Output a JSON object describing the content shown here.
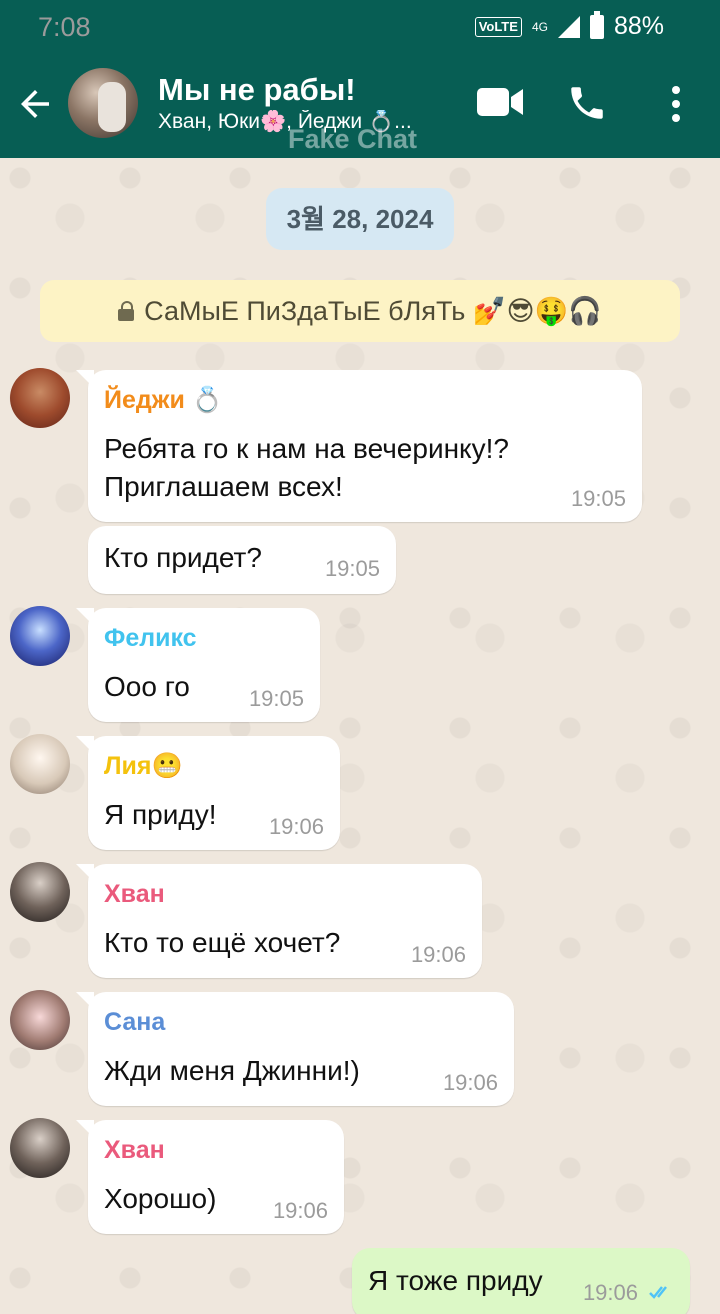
{
  "status_bar": {
    "time": "7:08",
    "network": "VoLTE",
    "network_gen": "4G",
    "battery_percent": "88%"
  },
  "header": {
    "title": "Мы не рабы!",
    "subtitle": "Хван, Юки🌸, Йеджи 💍...",
    "watermark": "Fake Chat"
  },
  "date_chip": "3월 28, 2024",
  "pinned_banner": {
    "text": "СаМыЕ ПиЗдаТыЕ бЛяТь 💅😎🤑🎧"
  },
  "messages": [
    {
      "sender": "Йеджи 💍",
      "text": "Ребята го к нам на вечеринку!?\nПриглашаем всех!",
      "time": "19:05",
      "color": "#f28c1b"
    },
    {
      "text": "Кто придет?",
      "time": "19:05"
    },
    {
      "sender": "Феликс",
      "text": "Ооо го",
      "time": "19:05",
      "color": "#41c3ee"
    },
    {
      "sender": "Лия😬",
      "text": "Я приду!",
      "time": "19:06",
      "color": "#f4c20d"
    },
    {
      "sender": "Хван",
      "text": "Кто то ещё хочет?",
      "time": "19:06",
      "color": "#ea5a7c"
    },
    {
      "sender": "Сана",
      "text": "Жди меня Джинни!)",
      "time": "19:06",
      "color": "#5b8ed6"
    },
    {
      "sender": "Хван",
      "text": "Хорошо)",
      "time": "19:06",
      "color": "#ea5a7c"
    },
    {
      "outgoing": true,
      "text": "Я тоже приду",
      "time": "19:06"
    }
  ],
  "icons": {
    "back": "arrow-left-icon",
    "video": "video-call-icon",
    "phone": "phone-icon",
    "menu": "more-vert-icon",
    "lock": "lock-icon",
    "read": "double-check-icon"
  }
}
